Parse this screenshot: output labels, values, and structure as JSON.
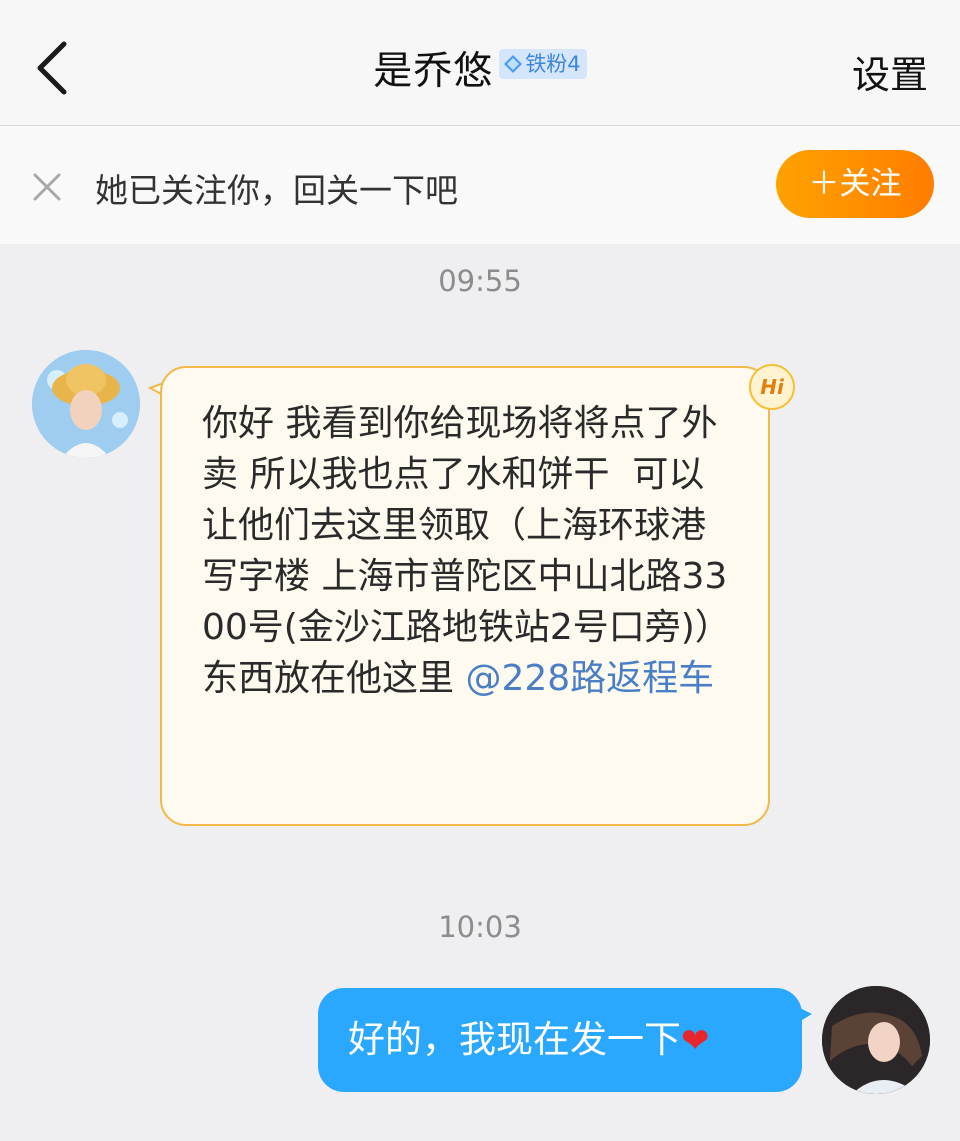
{
  "header": {
    "title": "是乔悠",
    "badge_label": "铁粉4",
    "settings_label": "设置"
  },
  "follow_prompt": {
    "text": "她已关注你，回关一下吧",
    "button_label": "＋关注"
  },
  "messages": [
    {
      "timestamp": "09:55",
      "direction": "incoming",
      "text": "你好 我看到你给现场将将点了外卖 所以我也点了水和饼干  可以让他们去这里领取（上海环球港写字楼 上海市普陀区中山北路3300号(金沙江路地铁站2号口旁)）\n东西放在他这里 ",
      "mention": "@228路返程车",
      "badge": "Hi"
    },
    {
      "timestamp": "10:03",
      "direction": "outgoing",
      "text": "好的，我现在发一下",
      "emoji": "❤"
    }
  ],
  "colors": {
    "outgoing_bubble": "#2aa8ff",
    "incoming_bubble": "#fefaef",
    "incoming_border": "#f2b94a",
    "follow_button": "#ff8c00",
    "mention": "#4a7fc6"
  }
}
